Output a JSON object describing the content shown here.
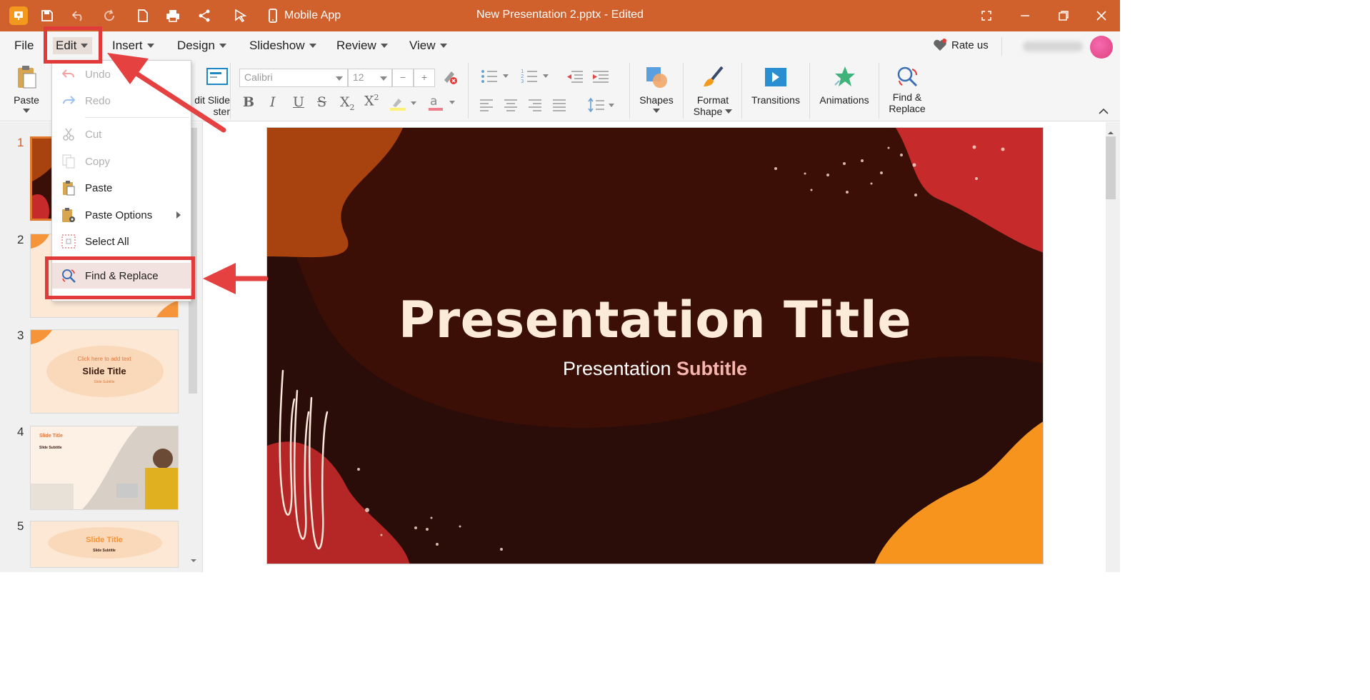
{
  "titlebar": {
    "mobile_app_label": "Mobile App",
    "document_title": "New Presentation 2.pptx - Edited"
  },
  "menubar": {
    "items": [
      {
        "label": "File"
      },
      {
        "label": "Edit"
      },
      {
        "label": "Insert"
      },
      {
        "label": "Design"
      },
      {
        "label": "Slideshow"
      },
      {
        "label": "Review"
      },
      {
        "label": "View"
      }
    ],
    "rate_us": "Rate us"
  },
  "ribbon": {
    "paste": "Paste",
    "edit_slide_master": "dit Slide",
    "edit_slide_master_2": "ster",
    "font_name_placeholder": "Calibri",
    "font_size_placeholder": "12",
    "shapes": "Shapes",
    "format_shape_1": "Format",
    "format_shape_2": "Shape",
    "transitions": "Transitions",
    "animations": "Animations",
    "find_replace_1": "Find &",
    "find_replace_2": "Replace"
  },
  "edit_menu": {
    "undo": "Undo",
    "redo": "Redo",
    "cut": "Cut",
    "copy": "Copy",
    "paste": "Paste",
    "paste_options": "Paste Options",
    "select_all": "Select All",
    "find_replace": "Find & Replace"
  },
  "slides": {
    "numbers": [
      "1",
      "2",
      "3",
      "4",
      "5"
    ],
    "thumb3_hint": "Click here to add text",
    "thumb3_title": "Slide Title",
    "thumb3_sub": "Slide Subtitle",
    "thumb4_title": "Slide Title",
    "thumb4_sub": "Slide Subtitle",
    "thumb5_title": "Slide Title",
    "thumb5_sub": "Slide Subtitle"
  },
  "slide": {
    "title": "Presentation Title",
    "subtitle_plain": "Presentation ",
    "subtitle_highlight": "Subtitle"
  },
  "colors": {
    "titlebar": "#d0602c",
    "accent_red": "#e03a3a",
    "slide_bg": "#2a0c08"
  }
}
